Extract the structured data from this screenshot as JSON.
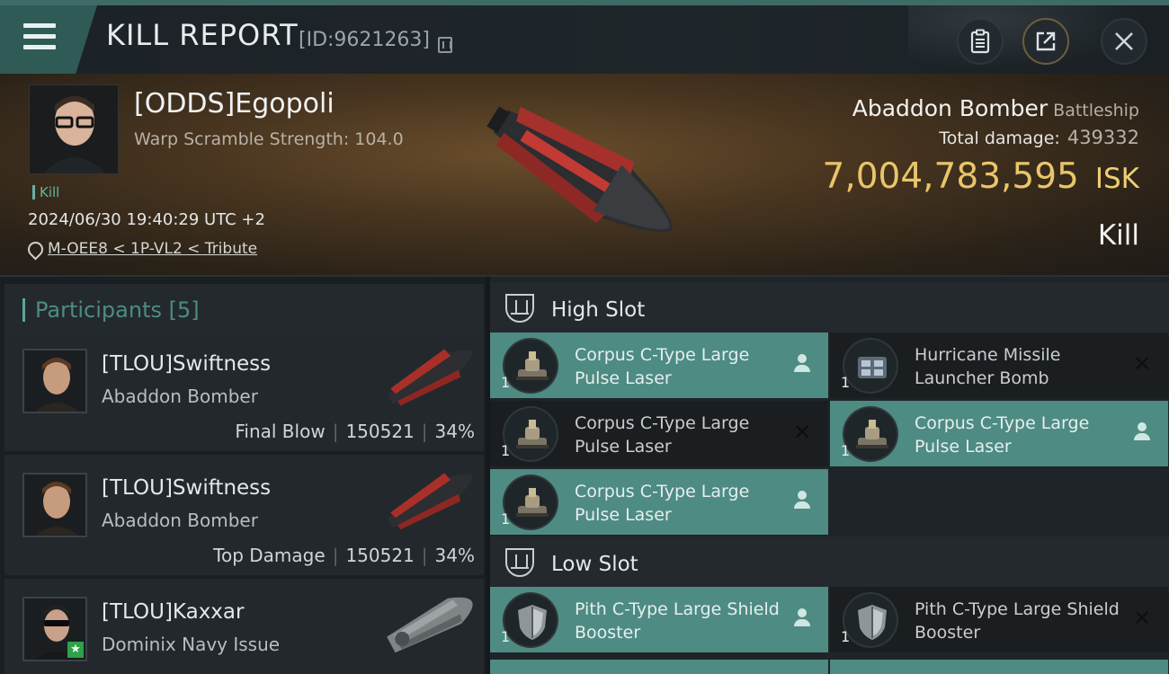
{
  "header": {
    "title": "KILL REPORT",
    "report_id": "[ID:9621263]",
    "icons": {
      "menu": "hamburger-menu-icon",
      "copy": "copy-icon",
      "clipboard": "clipboard-icon",
      "share": "share-icon",
      "close": "close-icon"
    }
  },
  "victim": {
    "name": "[ODDS]Egopoli",
    "warp_scramble": "Warp Scramble Strength: 104.0",
    "kill_tag": "Kill",
    "timestamp": "2024/06/30 19:40:29 UTC +2",
    "location": "M-OEE8 < 1P-VL2 < Tribute",
    "ship_name": "Abaddon Bomber",
    "ship_class": "Battleship",
    "total_damage_label": "Total damage:",
    "total_damage": "439332",
    "isk_value": "7,004,783,595",
    "isk_unit": "ISK",
    "result": "Kill",
    "colors": {
      "isk": "#e9c56a",
      "accent": "#4e8b82"
    }
  },
  "participants": {
    "header": "Participants [5]",
    "items": [
      {
        "name": "[TLOU]Swiftness",
        "ship": "Abaddon Bomber",
        "role": "Final Blow",
        "damage": "150521",
        "percent": "34%"
      },
      {
        "name": "[TLOU]Swiftness",
        "ship": "Abaddon Bomber",
        "role": "Top Damage",
        "damage": "150521",
        "percent": "34%"
      },
      {
        "name": "[TLOU]Kaxxar",
        "ship": "Dominix Navy Issue"
      }
    ]
  },
  "fitting": {
    "high_slot": {
      "label": "High Slot",
      "modules": [
        {
          "name": "Corpus C-Type Large Pulse Laser",
          "qty": "1",
          "status": "dropped"
        },
        {
          "name": "Hurricane Missile Launcher Bomb",
          "qty": "1",
          "status": "destroyed"
        },
        {
          "name": "Corpus C-Type Large Pulse Laser",
          "qty": "1",
          "status": "destroyed"
        },
        {
          "name": "Corpus C-Type Large Pulse Laser",
          "qty": "1",
          "status": "dropped"
        },
        {
          "name": "Corpus C-Type Large Pulse Laser",
          "qty": "1",
          "status": "dropped"
        }
      ]
    },
    "low_slot": {
      "label": "Low Slot",
      "modules": [
        {
          "name": "Pith C-Type Large Shield Booster",
          "qty": "1",
          "status": "dropped"
        },
        {
          "name": "Pith C-Type Large Shield Booster",
          "qty": "1",
          "status": "destroyed"
        }
      ]
    }
  }
}
